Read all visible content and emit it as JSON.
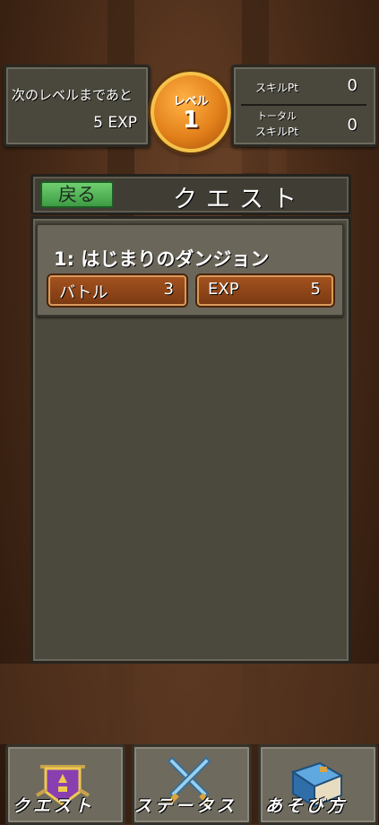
{
  "header": {
    "next_level_label": "次のレベルまであと",
    "next_level_value": "5 EXP",
    "level_badge_label": "レベル",
    "level_value": "1",
    "skill_pt_label": "スキルPt",
    "skill_pt_value": "0",
    "total_skill_pt_label_line1": "トータル",
    "total_skill_pt_label_line2": "スキルPt",
    "total_skill_pt_value": "0"
  },
  "title_bar": {
    "back_label": "戻る",
    "title": "クエスト"
  },
  "quests": [
    {
      "title": "1: はじまりのダンジョン",
      "battle_label": "バトル",
      "battle_value": "3",
      "exp_label": "EXP",
      "exp_value": "5"
    }
  ],
  "bottom_nav": [
    {
      "label": "クエスト",
      "icon": "shield-crest-icon"
    },
    {
      "label": "ステータス",
      "icon": "crossed-swords-icon"
    },
    {
      "label": "あそび方",
      "icon": "book-icon"
    }
  ],
  "colors": {
    "back_button": "#4fb657",
    "badge": "#e3811b",
    "pill": "#8e4518",
    "panel": "#4b483d"
  }
}
